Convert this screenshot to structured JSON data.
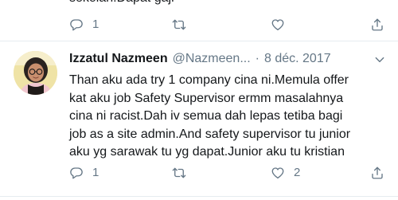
{
  "previous_tweet": {
    "text_tail": "sekolah.Dapat gaji",
    "actions": {
      "reply_count": "1",
      "retweet_count": "",
      "like_count": ""
    }
  },
  "tweet": {
    "display_name": "Izzatul Nazmeen",
    "handle": "@Nazmeen...",
    "separator": "·",
    "date": "8 déc. 2017",
    "text_lines": [
      "Than aku ada try 1 company cina ni.Memula offer",
      "kat aku job Safety Supervisor ermm masalahnya",
      "cina ni racist.Dah iv semua dah lepas tetiba bagi",
      "job as a site admin.And safety supervisor tu junior",
      "aku yg sarawak tu yg dapat.Junior aku tu kristian"
    ],
    "actions": {
      "reply_count": "1",
      "retweet_count": "",
      "like_count": "2"
    }
  },
  "icons": {
    "reply": "reply-icon",
    "retweet": "retweet-icon",
    "like": "heart-icon",
    "share": "share-icon",
    "menu": "chevron-down-icon"
  },
  "colors": {
    "text_primary": "#14171a",
    "text_secondary": "#657786",
    "divider": "#e6ecf0",
    "background": "#ffffff"
  }
}
